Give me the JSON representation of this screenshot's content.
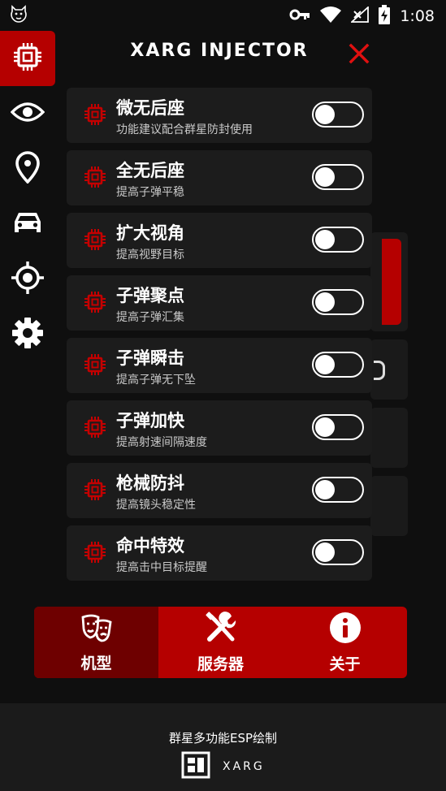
{
  "status_bar": {
    "time": "1:08",
    "icons": [
      "app-notification-icon",
      "vpn-key-icon",
      "wifi-icon",
      "no-signal-icon",
      "battery-charging-icon"
    ]
  },
  "sidebar": {
    "items": [
      {
        "name": "chip",
        "icon": "chip-icon",
        "active": true
      },
      {
        "name": "eye",
        "icon": "eye-icon",
        "active": false
      },
      {
        "name": "location",
        "icon": "location-pin-icon",
        "active": false
      },
      {
        "name": "car",
        "icon": "car-icon",
        "active": false
      },
      {
        "name": "target",
        "icon": "crosshair-icon",
        "active": false
      },
      {
        "name": "settings",
        "icon": "gear-icon",
        "active": false
      }
    ]
  },
  "panel": {
    "title": "XARG INJECTOR",
    "items": [
      {
        "title": "微无后座",
        "subtitle": "功能建议配合群星防封使用",
        "enabled": false
      },
      {
        "title": "全无后座",
        "subtitle": "提高子弹平稳",
        "enabled": false
      },
      {
        "title": "扩大视角",
        "subtitle": "提高视野目标",
        "enabled": false
      },
      {
        "title": "子弹聚点",
        "subtitle": "提高子弹汇集",
        "enabled": false
      },
      {
        "title": "子弹瞬击",
        "subtitle": "提高子弹无下坠",
        "enabled": false
      },
      {
        "title": "子弹加快",
        "subtitle": "提高射速间隔速度",
        "enabled": false
      },
      {
        "title": "枪械防抖",
        "subtitle": "提高镜头稳定性",
        "enabled": false
      },
      {
        "title": "命中特效",
        "subtitle": "提高击中目标提醒",
        "enabled": false
      }
    ]
  },
  "tabs": [
    {
      "label": "机型",
      "icon": "masks-icon",
      "active": true
    },
    {
      "label": "服务器",
      "icon": "tools-icon",
      "active": false
    },
    {
      "label": "关于",
      "icon": "info-icon",
      "active": false
    }
  ],
  "footer": {
    "text": "群星多功能ESP绘制",
    "brand": "XARG"
  },
  "colors": {
    "accent": "#b50000",
    "accent_dark": "#6e0000",
    "background": "#0f0f0f",
    "card": "#1c1c1c"
  }
}
